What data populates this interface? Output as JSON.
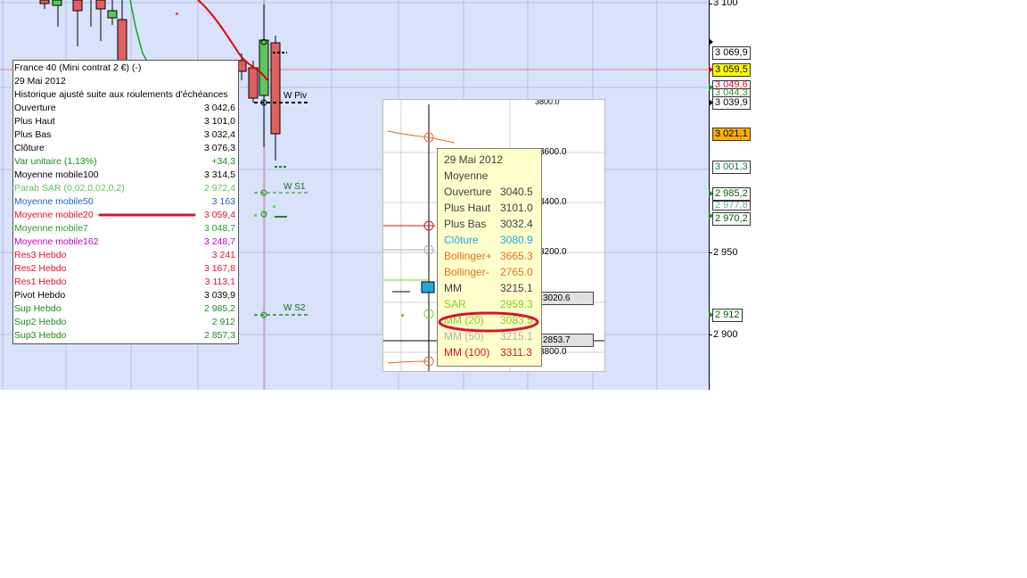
{
  "price_axis": {
    "ticks": [
      "3 100",
      "2 950",
      "2 900"
    ],
    "tags": [
      {
        "label": "3 069,9",
        "color": "#000000",
        "bg": "#ffffff"
      },
      {
        "label": "3 059,5",
        "color": "#000000",
        "bg": "#ffff00"
      },
      {
        "label": "3 049,6",
        "color": "#e0102e",
        "bg": "#ffffff"
      },
      {
        "label": "3 044,3",
        "color": "#2e9a2e",
        "bg": "#ffffff"
      },
      {
        "label": "3 039,9",
        "color": "#000000",
        "bg": "#ffffff"
      },
      {
        "label": "3 021,1",
        "color": "#000000",
        "bg": "#ffb000"
      },
      {
        "label": "3 001,3",
        "color": "#0a7a4a",
        "bg": "#ffffff"
      },
      {
        "label": "2 985,2",
        "color": "#006000",
        "bg": "#ffffff"
      },
      {
        "label": "2 977,8",
        "color": "#60b0a0",
        "bg": "#ffffff"
      },
      {
        "label": "2 970,2",
        "color": "#006000",
        "bg": "#ffffff"
      },
      {
        "label": "2 912",
        "color": "#006000",
        "bg": "#ffffff"
      }
    ]
  },
  "chart_labels": {
    "wpiv": "W Piv",
    "ws1": "W S1",
    "ws2": "W S2"
  },
  "info_panel": {
    "title": "France 40 (Mini contrat 2 €) (-)",
    "date": "29 Mai 2012",
    "note": "Historique ajusté suite aux roulements d'échéances",
    "rows": [
      {
        "label": "Ouverture",
        "value": "3 042,6",
        "color": "#000000"
      },
      {
        "label": "Plus Haut",
        "value": "3 101,0",
        "color": "#000000"
      },
      {
        "label": "Plus Bas",
        "value": "3 032,4",
        "color": "#000000"
      },
      {
        "label": "Clôture",
        "value": "3 076,3",
        "color": "#000000"
      },
      {
        "label": "Var unitaire (1,13%)",
        "value": "+34,3",
        "color": "#1a8a1a"
      },
      {
        "label": "Moyenne mobile100",
        "value": "3 314,5",
        "color": "#000000"
      },
      {
        "label": "Parab SAR (0,02,0,02,0,2)",
        "value": "2 972,4",
        "color": "#55c855"
      },
      {
        "label": "Moyenne mobile50",
        "value": "3 163",
        "color": "#2060d0"
      },
      {
        "label": "Moyenne mobile20",
        "value": "3 059,4",
        "color": "#e0102e"
      },
      {
        "label": "Moyenne mobile7",
        "value": "3 048,7",
        "color": "#1aa01a"
      },
      {
        "label": "Moyenne mobile162",
        "value": "3 248,7",
        "color": "#c000c0"
      },
      {
        "label": "Res3 Hebdo",
        "value": "3 241",
        "color": "#e0102e"
      },
      {
        "label": "Res2 Hebdo",
        "value": "3 167,8",
        "color": "#e0102e"
      },
      {
        "label": "Res1 Hebdo",
        "value": "3 113,1",
        "color": "#e0102e"
      },
      {
        "label": "Pivot Hebdo",
        "value": "3 039,9",
        "color": "#000000"
      },
      {
        "label": "Sup Hebdo",
        "value": "2 985,2",
        "color": "#1a8a1a"
      },
      {
        "label": "Sup2 Hebdo",
        "value": "2 912",
        "color": "#1a8a1a"
      },
      {
        "label": "Sup3 Hebdo",
        "value": "2 857,3",
        "color": "#1a8a1a"
      }
    ]
  },
  "inset": {
    "axis_ticks": [
      "3600.0",
      "3400.0",
      "3200.0",
      "3800.0"
    ],
    "boxes": [
      "3020.6",
      "2853.7"
    ],
    "top_tick": "3800.0"
  },
  "tooltip": {
    "date": "29 Mai 2012",
    "subtitle": "Moyenne",
    "rows": [
      {
        "label": "Ouverture",
        "value": "3040.5",
        "color": "#404040"
      },
      {
        "label": "Plus Haut",
        "value": "3101.0",
        "color": "#404040"
      },
      {
        "label": "Plus Bas",
        "value": "3032.4",
        "color": "#404040"
      },
      {
        "label": "Clôture",
        "value": "3080.9",
        "color": "#20a8e0"
      },
      {
        "label": "Bollinger+",
        "value": "3665.3",
        "color": "#e07020"
      },
      {
        "label": "Bollinger-",
        "value": "2765.0",
        "color": "#e07020"
      },
      {
        "label": "MM",
        "value": "3215.1",
        "color": "#404040"
      },
      {
        "label": "SAR",
        "value": "2959.3",
        "color": "#80d020"
      },
      {
        "label": "MM (20)",
        "value": "3083.5",
        "color": "#80d020"
      },
      {
        "label": "MM (50)",
        "value": "3215.1",
        "color": "#b0b0b0"
      },
      {
        "label": "MM (100)",
        "value": "3311.3",
        "color": "#d01818"
      }
    ]
  }
}
